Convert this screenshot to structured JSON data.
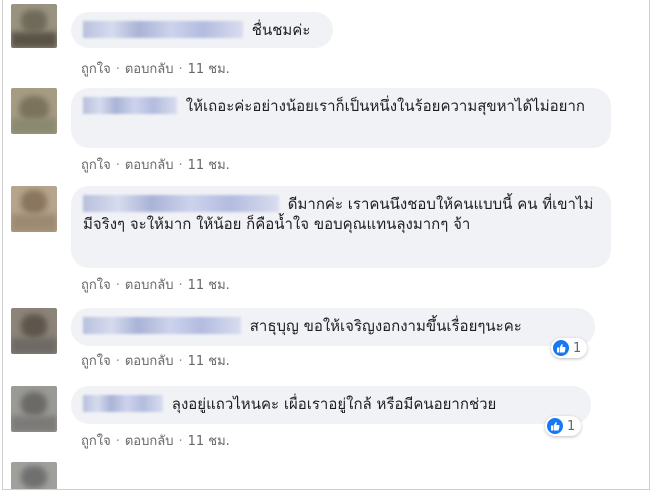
{
  "comments": [
    {
      "text": "ชื่นชมค่ะ",
      "actions": {
        "like": "ถูกใจ",
        "reply": "ตอบกลับ",
        "time": "11 ชม."
      }
    },
    {
      "text": "ให้เถอะค่ะอย่างน้อยเราก็เป็นหนึ่งในร้อยความสุขหาได้ไม่อยาก",
      "actions": {
        "like": "ถูกใจ",
        "reply": "ตอบกลับ",
        "time": "11 ชม."
      }
    },
    {
      "text": "ดีมากค่ะ เราคนนึงชอบให้คนแบบนี้ คน ที่เขาไม่มีจริงๆ จะให้มาก ให้น้อย ก็คือน้ำใจ ขอบคุณแทนลุงมากๆ จ้า",
      "actions": {
        "like": "ถูกใจ",
        "reply": "ตอบกลับ",
        "time": "11 ชม."
      }
    },
    {
      "text": "สาธุบุญ ขอให้เจริญงอกงามขึ้นเรื่อยๆนะคะ",
      "actions": {
        "like": "ถูกใจ",
        "reply": "ตอบกลับ",
        "time": "11 ชม."
      },
      "reaction_count": "1"
    },
    {
      "text": "ลุงอยู่แถวไหนคะ เผื่อเราอยู่ใกล้ หรือมีคนอยากช่วย",
      "actions": {
        "like": "ถูกใจ",
        "reply": "ตอบกลับ",
        "time": "11 ชม."
      },
      "reaction_count": "1"
    }
  ],
  "colors": {
    "bubble": "#f0f2f5",
    "meta_text": "#65676b",
    "like_blue": "#1877f2"
  },
  "icons": {
    "reaction": "like-thumb-icon"
  }
}
